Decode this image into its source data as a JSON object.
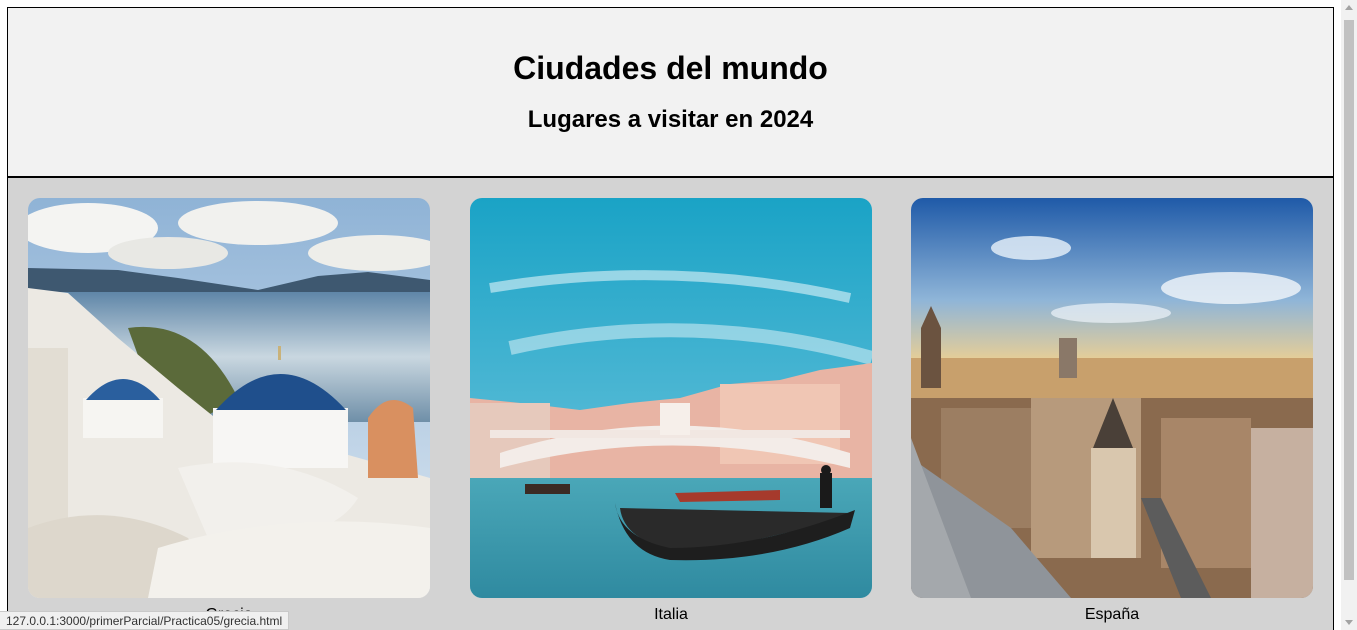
{
  "header": {
    "title": "Ciudades del mundo",
    "subtitle": "Lugares a visitar en 2024"
  },
  "cities": [
    {
      "caption": "Grecia",
      "icon": "santorini-photo"
    },
    {
      "caption": "Italia",
      "icon": "venice-photo"
    },
    {
      "caption": "España",
      "icon": "madrid-photo"
    }
  ],
  "status_bar": {
    "url": "127.0.0.1:3000/primerParcial/Practica05/grecia.html"
  }
}
